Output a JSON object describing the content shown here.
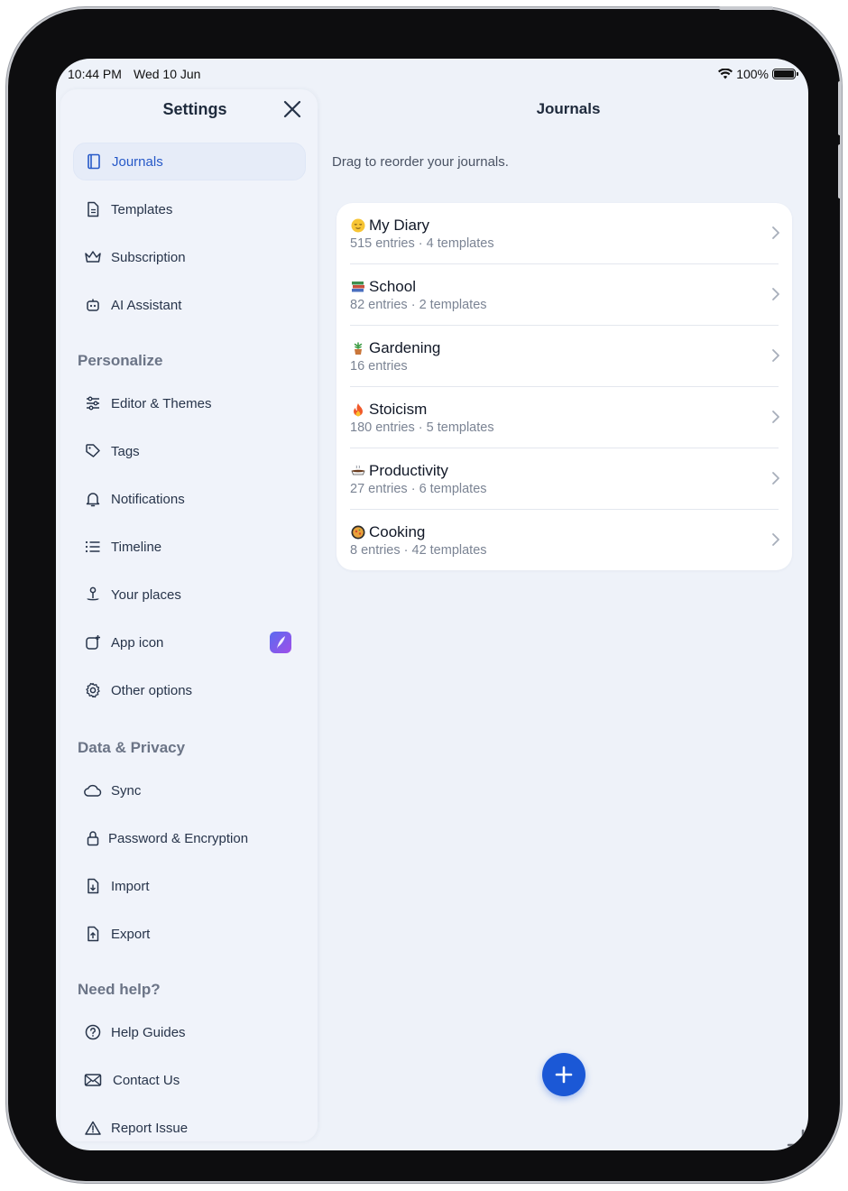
{
  "status_bar": {
    "time": "10:44 PM",
    "date": "Wed 10 Jun",
    "battery": "100%"
  },
  "sidebar": {
    "title": "Settings",
    "items_top": [
      {
        "label": "Journals",
        "icon": "book-icon",
        "active": true
      },
      {
        "label": "Templates",
        "icon": "document-icon"
      },
      {
        "label": "Subscription",
        "icon": "crown-icon"
      },
      {
        "label": "AI Assistant",
        "icon": "robot-icon"
      }
    ],
    "section_personalize": "Personalize",
    "items_personalize": [
      {
        "label": "Editor & Themes",
        "icon": "sliders-icon"
      },
      {
        "label": "Tags",
        "icon": "tag-icon"
      },
      {
        "label": "Notifications",
        "icon": "bell-icon"
      },
      {
        "label": "Timeline",
        "icon": "list-icon"
      },
      {
        "label": "Your places",
        "icon": "map-pin-icon"
      },
      {
        "label": "App icon",
        "icon": "app-icon-icon"
      },
      {
        "label": "Other options",
        "icon": "gear-icon"
      }
    ],
    "section_data": "Data & Privacy",
    "items_data": [
      {
        "label": "Sync",
        "icon": "cloud-icon"
      },
      {
        "label": "Password & Encryption",
        "icon": "lock-icon"
      },
      {
        "label": "Import",
        "icon": "file-import-icon"
      },
      {
        "label": "Export",
        "icon": "file-export-icon"
      }
    ],
    "section_help": "Need help?",
    "items_help": [
      {
        "label": "Help Guides",
        "icon": "question-circle-icon"
      },
      {
        "label": "Contact Us",
        "icon": "envelope-icon"
      },
      {
        "label": "Report Issue",
        "icon": "warning-icon"
      }
    ]
  },
  "main": {
    "title": "Journals",
    "hint": "Drag to reorder your journals.",
    "journals": [
      {
        "emoji": "😌",
        "name": "My Diary",
        "meta": "515 entries · 4 templates"
      },
      {
        "emoji": "📚",
        "name": "School",
        "meta": "82 entries · 2 templates"
      },
      {
        "emoji": "🪴",
        "name": "Gardening",
        "meta": "16 entries"
      },
      {
        "emoji": "🔥",
        "name": "Stoicism",
        "meta": "180 entries · 5 templates"
      },
      {
        "emoji": "☕",
        "name": "Productivity",
        "meta": "27 entries · 6 templates"
      },
      {
        "emoji": "🥘",
        "name": "Cooking",
        "meta": "8 entries · 42 templates"
      }
    ]
  },
  "colors": {
    "accent": "#1b58d6",
    "active_text": "#2659c8",
    "background": "#eef2f9"
  }
}
